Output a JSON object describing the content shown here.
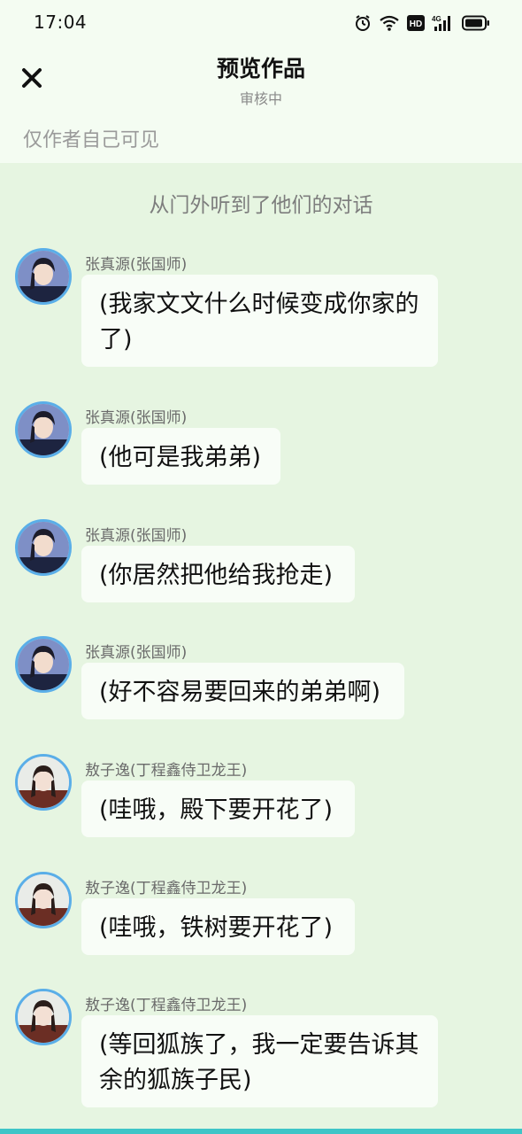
{
  "status_bar": {
    "time": "17:04",
    "icons": [
      "alarm-icon",
      "wifi-icon",
      "hd-icon",
      "signal-4g-icon",
      "battery-icon"
    ]
  },
  "header": {
    "close_icon": "close-icon",
    "title": "预览作品",
    "subtitle": "审核中"
  },
  "visibility_note": "仅作者自己可见",
  "scene_caption": "从门外听到了他们的对话",
  "messages": [
    {
      "sender": "张真源(张国师)",
      "text": "(我家文文什么时候变成你家的了)"
    },
    {
      "sender": "张真源(张国师)",
      "text": "(他可是我弟弟)"
    },
    {
      "sender": "张真源(张国师)",
      "text": "(你居然把他给我抢走)"
    },
    {
      "sender": "张真源(张国师)",
      "text": "(好不容易要回来的弟弟啊)"
    },
    {
      "sender": "敖子逸(丁程鑫侍卫龙王)",
      "text": "(哇哦，殿下要开花了)"
    },
    {
      "sender": "敖子逸(丁程鑫侍卫龙王)",
      "text": "(哇哦，铁树要开花了)"
    },
    {
      "sender": "敖子逸(丁程鑫侍卫龙王)",
      "text": "(等回狐族了，我一定要告诉其余的狐族子民)"
    }
  ],
  "colors": {
    "page_background": "#e6f5e1",
    "header_background": "#f4fcf2",
    "bubble_background": "#f8fdf7",
    "avatar_ring": "#5aaee8",
    "bottom_strip": "#3ec5c7"
  }
}
